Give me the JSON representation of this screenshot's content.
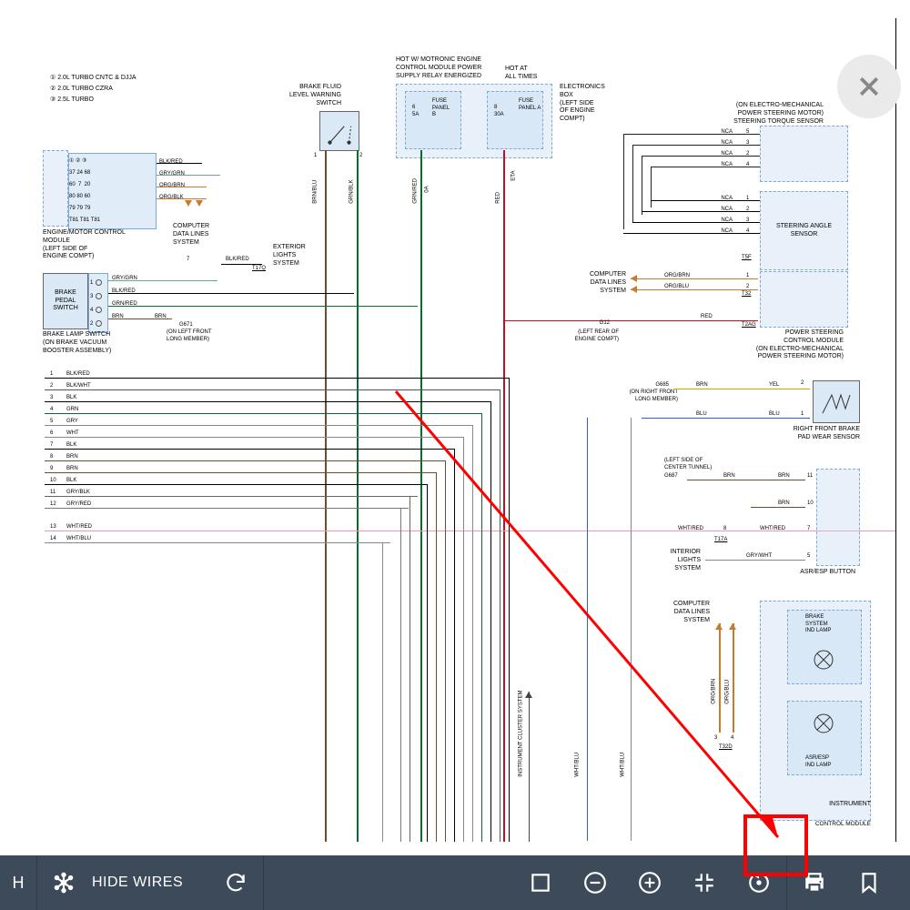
{
  "legend": {
    "l1": "① 2.0L TURBO CNTC & DJJA",
    "l2": "② 2.0L TURBO CZRA",
    "l3": "③ 2.5L TURBO"
  },
  "topcenter": {
    "brakefluid": "BRAKE FLUID\nLEVEL WARNING\nSWITCH",
    "hotmot": "HOT W/ MOTRONIC ENGINE\nCONTROL MODULE POWER\nSUPPLY RELAY ENERGIZED",
    "hotall": "HOT AT\nALL TIMES",
    "fuseB": "FUSE\nPANEL\nB",
    "fuse6": "6\n5A",
    "fuseA": "FUSE\nPANEL A",
    "fuse8": "8\n30A",
    "elecbox": "ELECTRONICS\nBOX\n(LEFT SIDE\nOF ENGINE\nCOMPT)"
  },
  "engmod": {
    "title": "ENGINE/MOTOR CONTROL\nMODULE\n(LEFT SIDE OF\nENGINE COMPT)",
    "rows": [
      {
        "p": "37 24 68",
        "c": "BLK/RED"
      },
      {
        "p": "60  7  20",
        "c": "GRY/GRN"
      },
      {
        "p": "80 80 60",
        "c": "ORG/BRN"
      },
      {
        "p": "79 79 79",
        "c": "ORG/BLK"
      },
      {
        "p": "T81 T81 T81",
        "c": ""
      }
    ],
    "cds": "COMPUTER\nDATA LINES\nSYSTEM"
  },
  "brakepedal": {
    "title": "BRAKE\nPEDAL\nSWITCH",
    "sub": "BRAKE LAMP SWITCH\n(ON BRAKE VACUUM\nBOOSTER ASSEMBLY)",
    "rows": [
      {
        "n": "1",
        "c": "GRY/GRN"
      },
      {
        "n": "3",
        "c": "BLK/RED"
      },
      {
        "n": "4",
        "c": "GRN/RED"
      },
      {
        "n": "2",
        "c": "BRN"
      }
    ],
    "brn": "BRN",
    "g671": "G671",
    "g671sub": "(ON LEFT FRONT\nLONG MEMBER)",
    "blkred": "BLK/RED",
    "t17q": "T17Q",
    "ext": "EXTERIOR\nLIGHTS\nSYSTEM"
  },
  "vertlabels": {
    "brnblu": "BRN/BLU",
    "grnblk": "GRN/BLK",
    "grnred": "GRN/RED",
    "red": "RED",
    "eta": "ETA",
    "oa": "0A"
  },
  "leftbus": [
    {
      "n": "1",
      "c": "BLK/RED"
    },
    {
      "n": "2",
      "c": "BLK/WHT"
    },
    {
      "n": "3",
      "c": "BLK"
    },
    {
      "n": "4",
      "c": "GRN"
    },
    {
      "n": "5",
      "c": "GRY"
    },
    {
      "n": "6",
      "c": "WHT"
    },
    {
      "n": "7",
      "c": "BLK"
    },
    {
      "n": "8",
      "c": "BRN"
    },
    {
      "n": "9",
      "c": "BRN"
    },
    {
      "n": "10",
      "c": "BLK"
    },
    {
      "n": "11",
      "c": "GRY/BLK"
    },
    {
      "n": "12",
      "c": "GRY/RED"
    },
    {
      "n": "13",
      "c": "WHT/RED"
    },
    {
      "n": "14",
      "c": "WHT/BLU"
    }
  ],
  "right": {
    "torque": "(ON ELECTRO-MECHANICAL\nPOWER STEERING MOTOR)\nSTEERING TORQUE SENSOR",
    "torquepins": [
      {
        "n": "5",
        "c": "NCA"
      },
      {
        "n": "3",
        "c": "NCA"
      },
      {
        "n": "2",
        "c": "NCA"
      },
      {
        "n": "4",
        "c": "NCA"
      }
    ],
    "anglesensor": "STEERING ANGLE\nSENSOR",
    "anglepins": [
      {
        "n": "1",
        "c": "NCA"
      },
      {
        "n": "2",
        "c": "NCA"
      },
      {
        "n": "3",
        "c": "NCA"
      },
      {
        "n": "4",
        "c": "NCA"
      }
    ],
    "t5f": "T5F",
    "cds": "COMPUTER\nDATA LINES\nSYSTEM",
    "orgbrn": "ORG/BRN",
    "orgblu": "ORG/BLU",
    "t32": "T32",
    "red": "RED",
    "pscm": "POWER STEERING\nCONTROL MODULE\n(ON ELECTRO-MECHANICAL\nPOWER STEERING MOTOR)",
    "g12": "G12",
    "g12sub": "(LEFT REAR OF\nENGINE COMPT)",
    "t2ag": "T2AG",
    "g685": "G685",
    "g685sub": "(ON RIGHT FRONT\nLONG MEMBER)",
    "brn": "BRN",
    "yel": "YEL",
    "blu": "BLU",
    "rfbrake": "RIGHT FRONT BRAKE\nPAD WEAR SENSOR",
    "tunnel": "(LEFT SIDE OF\nCENTER TUNNEL)",
    "g687": "G687",
    "brn2": "BRN",
    "p11": "11",
    "p10": "10",
    "whtred": "WHT/RED",
    "p8": "8",
    "p7": "7",
    "t17a": "T17A",
    "interior": "INTERIOR\nLIGHTS\nSYSTEM",
    "grywht": "GRY/WHT",
    "p5": "5",
    "asrbtn": "ASR/ESP BUTTON",
    "cds2": "COMPUTER\nDATA LINES\nSYSTEM",
    "orgbrn2": "ORG/BRN",
    "orgblu2": "ORG/BLU",
    "t32d": "T32D",
    "p3": "3",
    "p4": "4",
    "brakelamp": "BRAKE\nSYSTEM\nIND LAMP",
    "asrlamp": "ASR/ESP\nIND LAMP",
    "instrument": "INSTRUMENT",
    "ctrlmod": "CONTROL MODULE"
  },
  "vertmid": {
    "ics": "INSTRUMENT CLUSTER SYSTEM",
    "whtblu": "WHT/BLU"
  },
  "toolbar": {
    "search": "H",
    "hidewires": "HIDE WIRES"
  }
}
